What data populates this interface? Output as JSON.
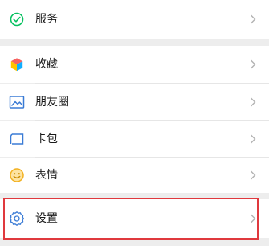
{
  "menu": {
    "service": {
      "label": "服务",
      "icon": "service-check-icon",
      "color": "#07c160"
    },
    "favorites": {
      "label": "收藏",
      "icon": "favorites-cube-icon"
    },
    "moments": {
      "label": "朋友圈",
      "icon": "moments-photo-icon",
      "color": "#3a7bd5"
    },
    "cards": {
      "label": "卡包",
      "icon": "card-wallet-icon",
      "color": "#3a7bd5"
    },
    "stickers": {
      "label": "表情",
      "icon": "sticker-smile-icon",
      "color": "#f2b01e"
    },
    "settings": {
      "label": "设置",
      "icon": "settings-gear-icon",
      "color": "#3a7bd5"
    }
  },
  "highlight_color": "#e0393e"
}
